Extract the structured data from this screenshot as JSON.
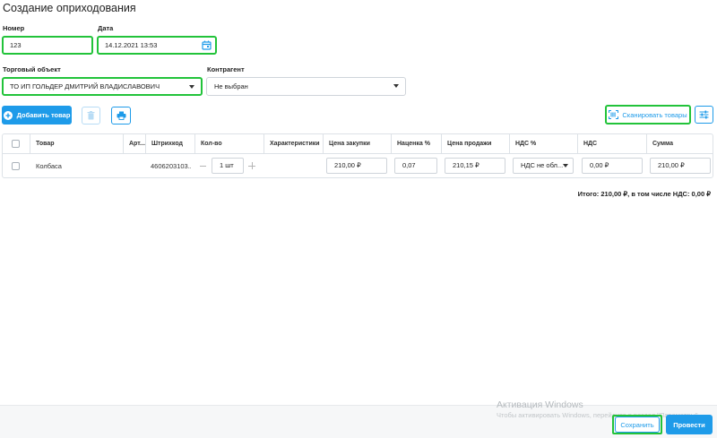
{
  "page": {
    "title": "Создание оприходования"
  },
  "form": {
    "number": {
      "label": "Номер",
      "value": "123"
    },
    "date": {
      "label": "Дата",
      "value": "14.12.2021 13:53"
    },
    "trade_object": {
      "label": "Торговый объект",
      "value": "ТО ИП ГОЛЬДЕР ДМИТРИЙ ВЛАДИСЛАВОВИЧ"
    },
    "counterparty": {
      "label": "Контрагент",
      "value": "Не выбран"
    }
  },
  "toolbar": {
    "add_label": "Добавить товар",
    "scan_label": "Сканировать товары"
  },
  "table": {
    "columns": [
      "Товар",
      "Арт...",
      "Штрихкод",
      "Кол-во",
      "Характеристики",
      "Цена закупки",
      "Наценка %",
      "Цена продажи",
      "НДС %",
      "НДС",
      "Сумма"
    ],
    "rows": [
      {
        "name": "Колбаса",
        "article": "",
        "barcode": "4606203103...",
        "qty": "1 шт",
        "characteristics": "",
        "purchase_price": "210,00 ₽",
        "markup": "0,07",
        "sale_price": "210,15 ₽",
        "vat_rate": "НДС не обл...",
        "vat": "0,00 ₽",
        "sum": "210,00 ₽"
      }
    ]
  },
  "summary": {
    "total_text": "Итого: 210,00 ₽, в том числе НДС: 0,00 ₽"
  },
  "footer": {
    "save_label": "Сохранить",
    "post_label": "Провести"
  },
  "watermark": {
    "title": "Активация Windows",
    "subtitle": "Чтобы активировать Windows, перейдите в раздел \"Параметры\"."
  },
  "colors": {
    "accent": "#1e9be9",
    "highlight": "#22c33a"
  },
  "icons": [
    "calendar-icon",
    "plus-circle-icon",
    "trash-icon",
    "print-icon",
    "barcode-scan-icon",
    "settings-sliders-icon",
    "chevron-down-icon"
  ]
}
